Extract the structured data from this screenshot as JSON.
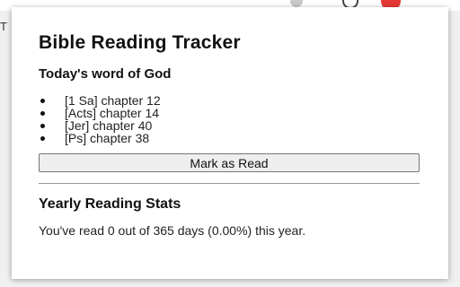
{
  "browser": {
    "edge_text": "T"
  },
  "popup": {
    "title": "Bible Reading Tracker",
    "today_heading": "Today's word of God",
    "readings": [
      "[1 Sa] chapter 12",
      "[Acts] chapter 14",
      "[Jer] chapter 40",
      "[Ps] chapter 38"
    ],
    "mark_button_label": "Mark as Read",
    "stats_heading": "Yearly Reading Stats",
    "stats_text": "You've read 0 out of 365 days (0.00%) this year."
  }
}
